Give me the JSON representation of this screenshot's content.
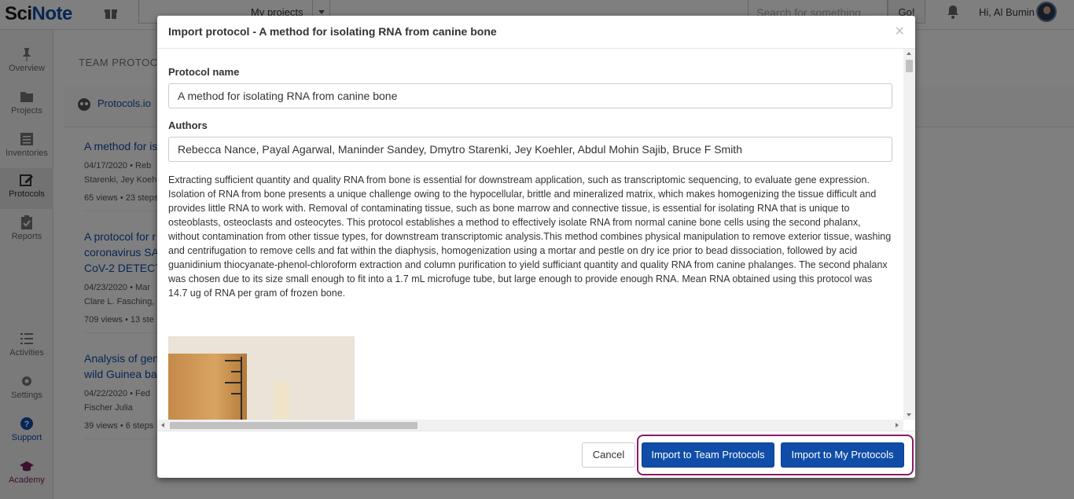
{
  "app": {
    "logo_left": "Sci",
    "logo_right": "Note",
    "project_select": "My projects",
    "search_placeholder": "Search for something...",
    "go_label": "Go!",
    "greeting": "Hi, Al Bumin"
  },
  "sidebar": {
    "items": [
      {
        "label": "Overview",
        "icon": "pin-icon"
      },
      {
        "label": "Projects",
        "icon": "folder-icon"
      },
      {
        "label": "Inventories",
        "icon": "list-icon"
      },
      {
        "label": "Protocols",
        "icon": "edit-icon"
      },
      {
        "label": "Reports",
        "icon": "clipboard-icon"
      },
      {
        "label": "Activities",
        "icon": "activity-icon"
      },
      {
        "label": "Settings",
        "icon": "gear-icon"
      },
      {
        "label": "Support",
        "icon": "help-icon"
      },
      {
        "label": "Academy",
        "icon": "graduation-cap-icon"
      }
    ]
  },
  "background": {
    "heading": "TEAM PROTOCO",
    "tab": "Protocols.io",
    "list": [
      {
        "title": "A method for is",
        "meta1": "04/17/2020 • Reb",
        "meta2": "Starenki, Jey Koeh",
        "stats": "65 views • 23 steps"
      },
      {
        "title": "A protocol for r coronavirus SA CoV-2 DETECT",
        "meta1": "04/23/2020 • Mar",
        "meta2": "Clare L. Fasching, J",
        "stats": "709 views • 13 ste"
      },
      {
        "title": "Analysis of gen wild Guinea ba",
        "meta1": "04/22/2020 • Fed",
        "meta2": "Fischer Julia",
        "stats": "39 views • 6 steps"
      }
    ]
  },
  "modal": {
    "title": "Import protocol - A method for isolating RNA from canine bone",
    "close": "×",
    "protocol_name_label": "Protocol name",
    "protocol_name_value": "A method for isolating RNA from canine bone",
    "authors_label": "Authors",
    "authors_value": "Rebecca Nance, Payal Agarwal, Maninder Sandey, Dmytro Starenki, Jey Koehler, Abdul Mohin Sajib, Bruce F Smith",
    "abstract": "Extracting sufficient quantity and quality RNA from bone is essential for downstream application, such as transcriptomic sequencing, to evaluate gene expression. Isolation of RNA from bone presents a unique challenge owing to the hypocellular, brittle and mineralized matrix, which makes homogenizing the tissue difficult and provides little RNA to work with. Removal of contaminating tissue, such as bone marrow and connective tissue, is essential for isolating RNA that is unique to osteoblasts, osteoclasts and osteocytes. This protocol establishes a method to effectively isolate RNA from normal canine bone cells using the second phalanx, without contamination from other tissue types, for downstream transcriptomic analysis.This method combines physical manipulation to remove exterior tissue, washing and centrifugation to remove cells and fat within the diaphysis, homogenization using a mortar and pestle on dry ice prior to bead dissociation, followed by acid guanidinium thiocyanate-phenol-chloroform extraction and column purification to yield sufficiant quantity and quality RNA from canine phalanges. The second phalanx was chosen due to its size small enough to fit into a 1.7 mL microfuge tube, but large enough to provide enough RNA. Mean RNA obtained using this protocol was 14.7 ug of RNA per gram of frozen bone.",
    "cancel_label": "Cancel",
    "import_team_label": "Import to Team Protocols",
    "import_my_label": "Import to My Protocols"
  },
  "colors": {
    "primary": "#104da9",
    "highlight": "#8b1a66"
  }
}
